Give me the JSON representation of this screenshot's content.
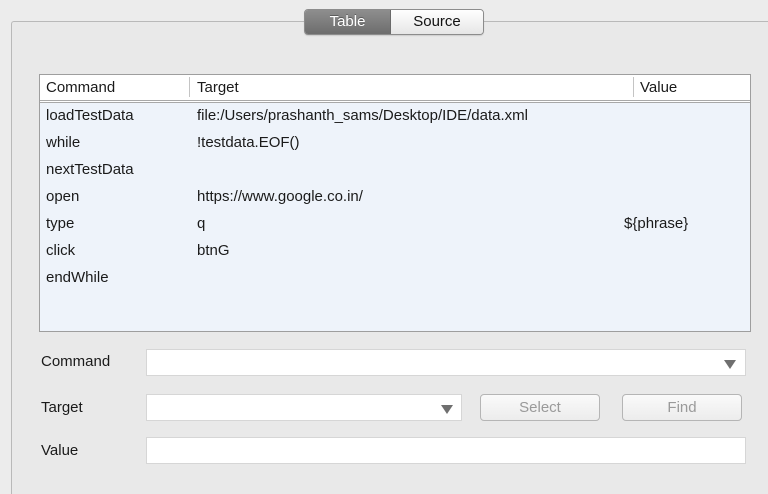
{
  "tabs": {
    "table_label": "Table",
    "source_label": "Source"
  },
  "table": {
    "headers": {
      "command": "Command",
      "target": "Target",
      "value": "Value"
    },
    "rows": [
      {
        "command": "loadTestData",
        "target": "file:/Users/prashanth_sams/Desktop/IDE/data.xml",
        "value": ""
      },
      {
        "command": "while",
        "target": "!testdata.EOF()",
        "value": ""
      },
      {
        "command": "nextTestData",
        "target": "",
        "value": ""
      },
      {
        "command": "open",
        "target": "https://www.google.co.in/",
        "value": ""
      },
      {
        "command": "type",
        "target": "q",
        "value": "${phrase}"
      },
      {
        "command": "click",
        "target": "btnG",
        "value": ""
      },
      {
        "command": "endWhile",
        "target": "",
        "value": ""
      }
    ]
  },
  "form": {
    "command_label": "Command",
    "target_label": "Target",
    "value_label": "Value",
    "command_value": "",
    "target_value": "",
    "value_value": "",
    "select_button": "Select",
    "find_button": "Find"
  },
  "icons": {
    "dropdown": "chevron-down-icon"
  }
}
